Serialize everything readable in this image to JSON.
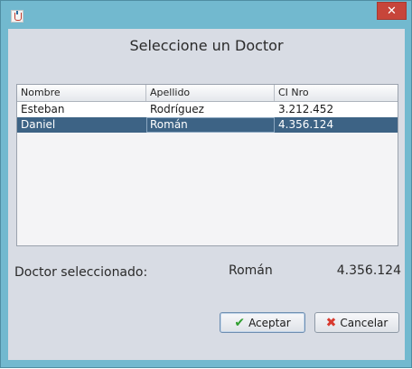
{
  "window": {
    "close_glyph": "✕"
  },
  "dialog": {
    "title": "Seleccione un Doctor"
  },
  "table": {
    "columns": [
      "Nombre",
      "Apellido",
      "CI Nro"
    ],
    "rows": [
      {
        "nombre": "Esteban",
        "apellido": "Rodríguez",
        "ci": "3.212.452"
      },
      {
        "nombre": "Daniel",
        "apellido": "Román",
        "ci": "4.356.124"
      }
    ],
    "selected_row_color": "#3d6385"
  },
  "selection": {
    "label": "Doctor seleccionado:",
    "apellido": "Román",
    "ci": "4.356.124"
  },
  "buttons": {
    "accept_label": "Aceptar",
    "accept_icon": "check-icon",
    "cancel_label": "Cancelar",
    "cancel_icon": "x-icon"
  },
  "colors": {
    "titlebar": "#72b9cf",
    "close_button": "#c7453a",
    "client_background": "#d8dce4"
  }
}
